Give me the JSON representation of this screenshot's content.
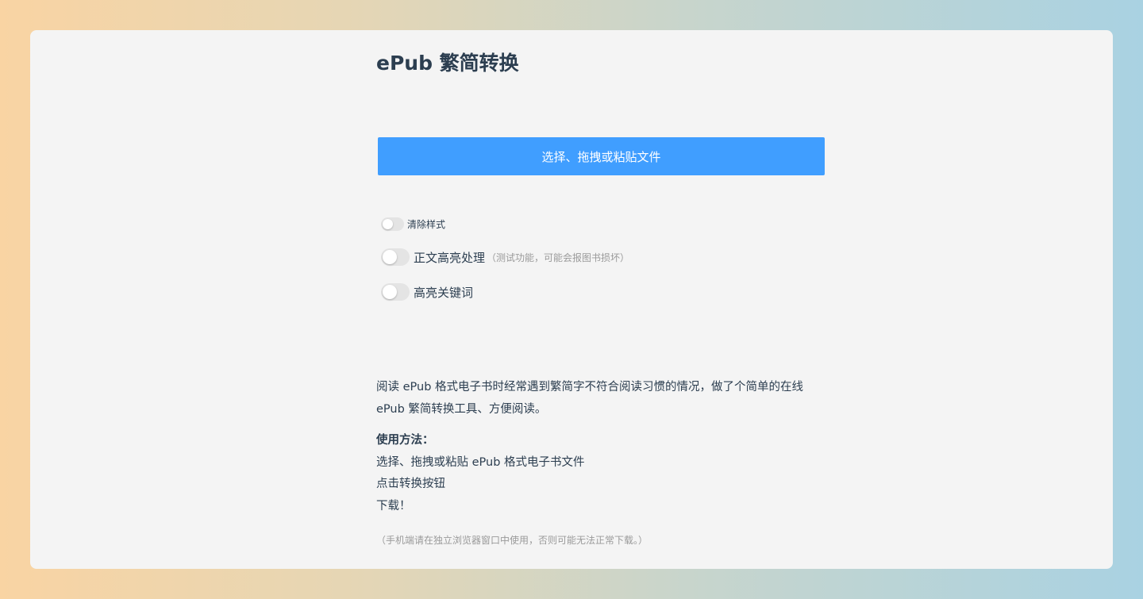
{
  "header": {
    "title": "ePub 繁简转换"
  },
  "upload": {
    "label": "选择、拖拽或粘贴文件"
  },
  "options": [
    {
      "label": "清除样式",
      "note": "",
      "enabled": false
    },
    {
      "label": "正文高亮处理",
      "note": "（测试功能，可能会报图书损坏）",
      "enabled": false
    },
    {
      "label": "高亮关键词",
      "note": "",
      "enabled": false
    }
  ],
  "description": {
    "intro_line1": "阅读 ePub 格式电子书时经常遇到繁简字不符合阅读习惯的情况，做了个简单的在线",
    "intro_line2": "ePub 繁简转换工具、方便阅读。",
    "usage_heading": "使用方法：",
    "steps": [
      "选择、拖拽或粘贴 ePub 格式电子书文件",
      "点击转换按钮",
      "下载！"
    ],
    "mobile_note": "（手机端请在独立浏览器窗口中使用，否则可能无法正常下载。）"
  },
  "colors": {
    "primary": "#409eff",
    "text": "#2c3e50",
    "muted": "#9a9a9a",
    "card": "#f4f4f4",
    "switch_off": "#e4e4e4"
  }
}
